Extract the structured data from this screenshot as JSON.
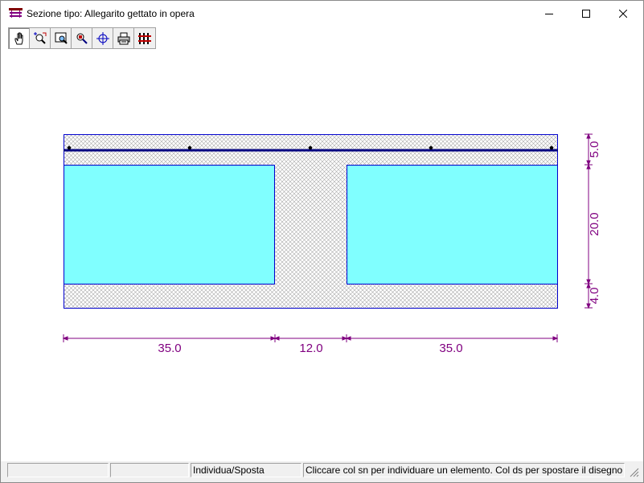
{
  "window": {
    "title": "Sezione tipo: Allegarito gettato in opera",
    "icon": "section-icon",
    "controls": {
      "minimize": "minimize-icon",
      "maximize": "maximize-icon",
      "close": "close-icon"
    }
  },
  "toolbar": {
    "tools": [
      {
        "name": "pan-hand-tool",
        "icon": "hand-icon",
        "active": true
      },
      {
        "name": "zoom-tool",
        "icon": "zoom-arrows-icon",
        "active": false
      },
      {
        "name": "zoom-window-tool",
        "icon": "zoom-window-icon",
        "active": false
      },
      {
        "name": "zoom-search-tool",
        "icon": "zoom-search-icon",
        "active": false
      },
      {
        "name": "crosshair-tool",
        "icon": "crosshair-icon",
        "active": false
      },
      {
        "name": "print-tool",
        "icon": "printer-icon",
        "active": false
      },
      {
        "name": "settings-tool",
        "icon": "sliders-icon",
        "active": false
      }
    ]
  },
  "drawing": {
    "colors": {
      "outline": "#0000cc",
      "block_fill": "#80ffff",
      "hatch": "#a8a8a8",
      "rebar": "#000080",
      "dimension": "#800080"
    },
    "horizontal_dimensions": [
      "35.0",
      "12.0",
      "35.0"
    ],
    "vertical_dimensions": [
      "5.0",
      "20.0",
      "4.0"
    ]
  },
  "statusbar": {
    "cells": [
      "",
      "",
      "Individua/Sposta",
      "Cliccare col sn per individuare un elemento. Col ds per spostare il disegno"
    ]
  }
}
